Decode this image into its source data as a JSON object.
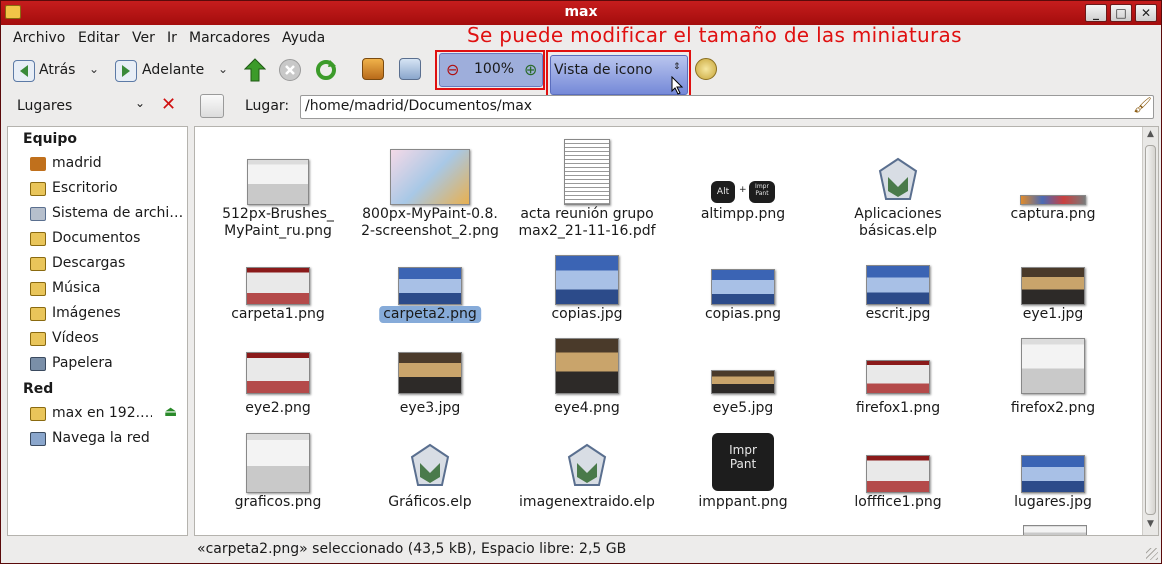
{
  "window": {
    "title": "max"
  },
  "menu": [
    "Archivo",
    "Editar",
    "Ver",
    "Ir",
    "Marcadores",
    "Ayuda"
  ],
  "annotation": "Se puede modificar el tamaño de las miniaturas",
  "toolbar": {
    "back_label": "Atrás",
    "forward_label": "Adelante",
    "zoom_value": "100%",
    "view_mode": "Vista de icono"
  },
  "location": {
    "places_label": "Lugares",
    "location_label": "Lugar:",
    "path": "/home/madrid/Documentos/max"
  },
  "sidebar": {
    "sections": [
      {
        "title": "Equipo",
        "items": [
          "madrid",
          "Escritorio",
          "Sistema de archi…",
          "Documentos",
          "Descargas",
          "Música",
          "Imágenes",
          "Vídeos",
          "Papelera"
        ]
      },
      {
        "title": "Red",
        "items": [
          "max en 192.…",
          "Navega la red"
        ]
      }
    ]
  },
  "files": [
    {
      "name": "512px-Brushes_\nMyPaint_ru.png"
    },
    {
      "name": "800px-MyPaint-0.8.\n2-screenshot_2.png"
    },
    {
      "name": "acta reunión grupo\nmax2_21-11-16.pdf"
    },
    {
      "name": "altimpp.png"
    },
    {
      "name": "Aplicaciones\nbásicas.elp"
    },
    {
      "name": "captura.png"
    },
    {
      "name": "carpeta1.png"
    },
    {
      "name": "carpeta2.png"
    },
    {
      "name": "copias.jpg"
    },
    {
      "name": "copias.png"
    },
    {
      "name": "escrit.jpg"
    },
    {
      "name": "eye1.jpg"
    },
    {
      "name": "eye2.png"
    },
    {
      "name": "eye3.jpg"
    },
    {
      "name": "eye4.png"
    },
    {
      "name": "eye5.jpg"
    },
    {
      "name": "firefox1.png"
    },
    {
      "name": "firefox2.png"
    },
    {
      "name": "graficos.png"
    },
    {
      "name": "Gráficos.elp"
    },
    {
      "name": "imagenextraido.elp"
    },
    {
      "name": "imppant.png"
    },
    {
      "name": "lofffice1.png"
    },
    {
      "name": "lugares.jpg"
    }
  ],
  "key_labels": {
    "alt": "Alt",
    "impr": "Impr\nPant"
  },
  "status": "«carpeta2.png» seleccionado (43,5 kB), Espacio libre: 2,5 GB",
  "colors": {
    "titlebar": "#b31515",
    "selection": "#86abd9",
    "annotation": "#e01010"
  }
}
